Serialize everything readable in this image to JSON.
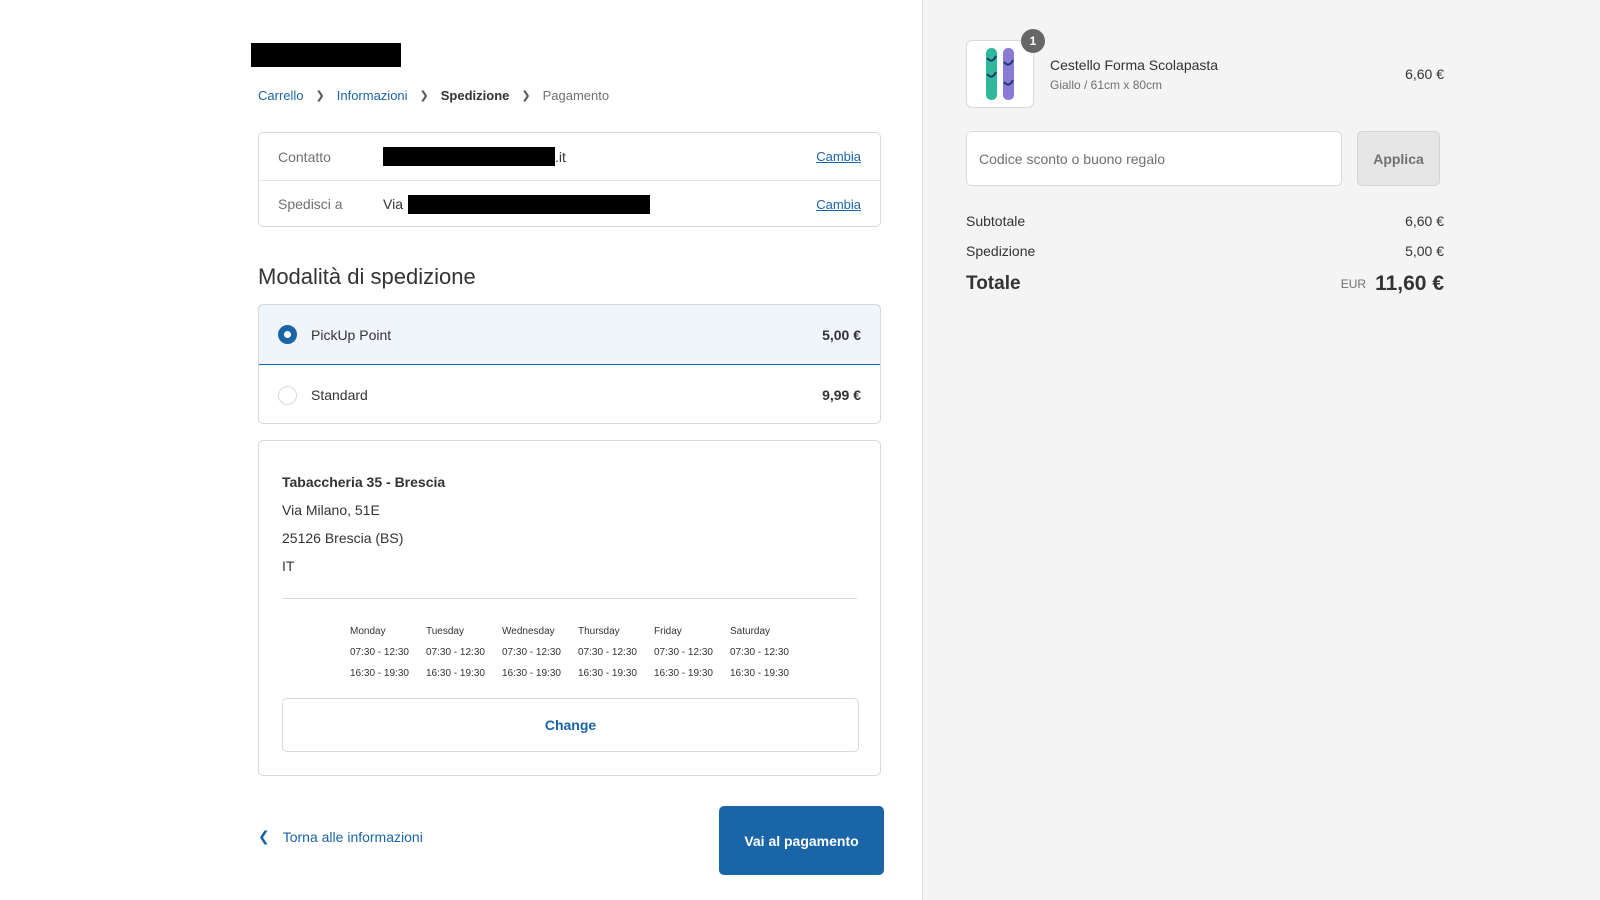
{
  "breadcrumb": {
    "items": [
      {
        "label": "Carrello",
        "state": "link"
      },
      {
        "label": "Informazioni",
        "state": "link"
      },
      {
        "label": "Spedizione",
        "state": "current"
      },
      {
        "label": "Pagamento",
        "state": "upcoming"
      }
    ]
  },
  "review": {
    "contact": {
      "label": "Contatto",
      "value_suffix": ".it",
      "change": "Cambia"
    },
    "ship_to": {
      "label": "Spedisci a",
      "value_prefix": "Via",
      "change": "Cambia"
    }
  },
  "shipping": {
    "title": "Modalità di spedizione",
    "methods": [
      {
        "label": "PickUp Point",
        "price": "5,00 €",
        "selected": true
      },
      {
        "label": "Standard",
        "price": "9,99 €",
        "selected": false
      }
    ]
  },
  "pickup": {
    "name": "Tabaccheria 35 - Brescia",
    "street": "Via Milano, 51E",
    "city": "25126 Brescia (BS)",
    "country": "IT",
    "hours": [
      {
        "day": "Monday",
        "morning": "07:30 - 12:30",
        "afternoon": "16:30 - 19:30"
      },
      {
        "day": "Tuesday",
        "morning": "07:30 - 12:30",
        "afternoon": "16:30 - 19:30"
      },
      {
        "day": "Wednesday",
        "morning": "07:30 - 12:30",
        "afternoon": "16:30 - 19:30"
      },
      {
        "day": "Thursday",
        "morning": "07:30 - 12:30",
        "afternoon": "16:30 - 19:30"
      },
      {
        "day": "Friday",
        "morning": "07:30 - 12:30",
        "afternoon": "16:30 - 19:30"
      },
      {
        "day": "Saturday",
        "morning": "07:30 - 12:30",
        "afternoon": "16:30 - 19:30"
      }
    ],
    "change_label": "Change"
  },
  "footer": {
    "back_label": "Torna alle informazioni",
    "continue_label": "Vai al pagamento"
  },
  "order": {
    "product": {
      "name": "Cestello Forma Scolapasta",
      "variant": "Giallo / 61cm x 80cm",
      "price": "6,60 €",
      "quantity": "1"
    },
    "discount": {
      "placeholder": "Codice sconto o buono regalo",
      "apply_label": "Applica"
    },
    "subtotal": {
      "label": "Subtotale",
      "value": "6,60 €"
    },
    "shipping": {
      "label": "Spedizione",
      "value": "5,00 €"
    },
    "total": {
      "label": "Totale",
      "currency": "EUR",
      "value": "11,60 €"
    }
  },
  "colors": {
    "accent": "#1a64a8",
    "sidebar_bg": "#f4f4f4",
    "selected_bg": "#f0f5fc"
  }
}
